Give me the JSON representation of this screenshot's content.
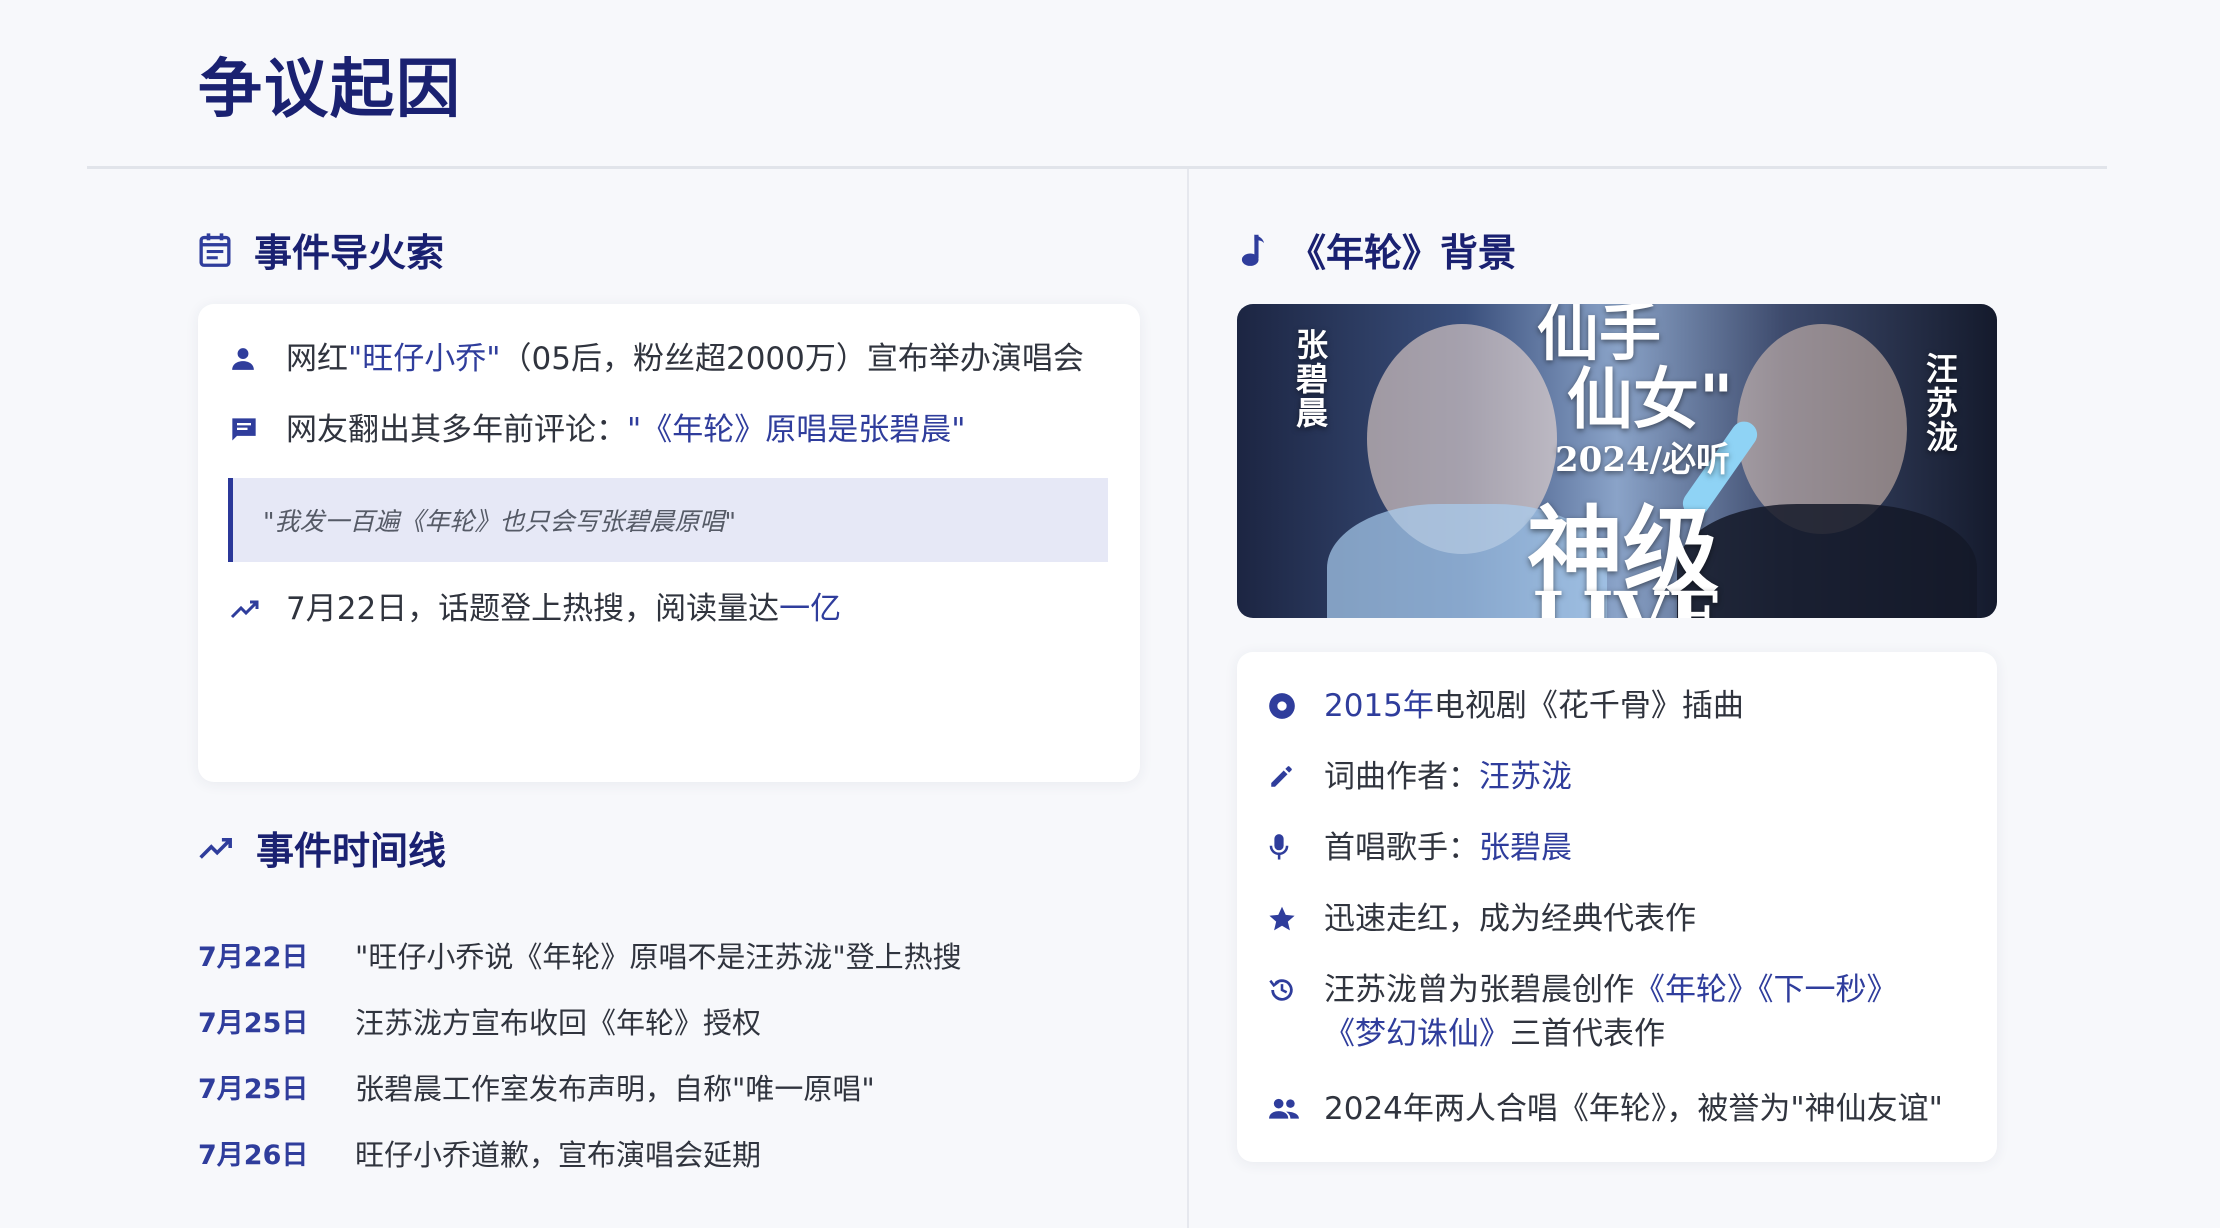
{
  "page": {
    "title": "争议起因"
  },
  "trigger": {
    "heading": "事件导火索",
    "row1": {
      "pre": "网红",
      "name": "\"旺仔小乔\"",
      "post": "（05后，粉丝超2000万）宣布举办演唱会"
    },
    "row2": {
      "pre": "网友翻出其多年前评论：",
      "hl": "\"《年轮》原唱是张碧晨\""
    },
    "quote": "\"我发一百遍《年轮》也只会写张碧晨原唱\"",
    "row3": {
      "pre": "7月22日，话题登上热搜，阅读量达",
      "hl": "一亿"
    }
  },
  "timeline": {
    "heading": "事件时间线",
    "items": [
      {
        "date": "7月22日",
        "text": "\"旺仔小乔说《年轮》原唱不是汪苏泷\"登上热搜"
      },
      {
        "date": "7月25日",
        "text": "汪苏泷方宣布收回《年轮》授权"
      },
      {
        "date": "7月25日",
        "text": "张碧晨工作室发布声明，自称\"唯一原唱\""
      },
      {
        "date": "7月26日",
        "text": "旺仔小乔道歉，宣布演唱会延期"
      }
    ]
  },
  "background": {
    "heading": "《年轮》背景",
    "banner": {
      "name_left": "张碧晨",
      "name_right": "汪苏泷",
      "line1": "仙手",
      "line2": "仙女\"",
      "line3": "2024/必听",
      "line4": "神级",
      "line5": "LIVE"
    },
    "facts": {
      "f1": {
        "hl": "2015年",
        "post": "电视剧《花千骨》插曲"
      },
      "f2": {
        "pre": "词曲作者：",
        "hl": "汪苏泷"
      },
      "f3": {
        "pre": "首唱歌手：",
        "hl": "张碧晨"
      },
      "f4": {
        "text": "迅速走红，成为经典代表作"
      },
      "f5": {
        "pre": "汪苏泷曾为张碧晨创作",
        "hl1": "《年轮》《下一秒》",
        "hl2": "《梦幻诛仙》",
        "post": "三首代表作"
      },
      "f6": {
        "text": "2024年两人合唱《年轮》，被誉为\"神仙友谊\""
      }
    }
  },
  "colors": {
    "primary": "#1a2171",
    "accent": "#2f3d9c",
    "quote_bg": "#e6e8f6"
  },
  "icons": [
    "calendar-icon",
    "person-icon",
    "comment-icon",
    "trending-icon",
    "music-note-icon",
    "disc-icon",
    "pencil-icon",
    "microphone-icon",
    "star-icon",
    "history-icon",
    "people-icon"
  ]
}
